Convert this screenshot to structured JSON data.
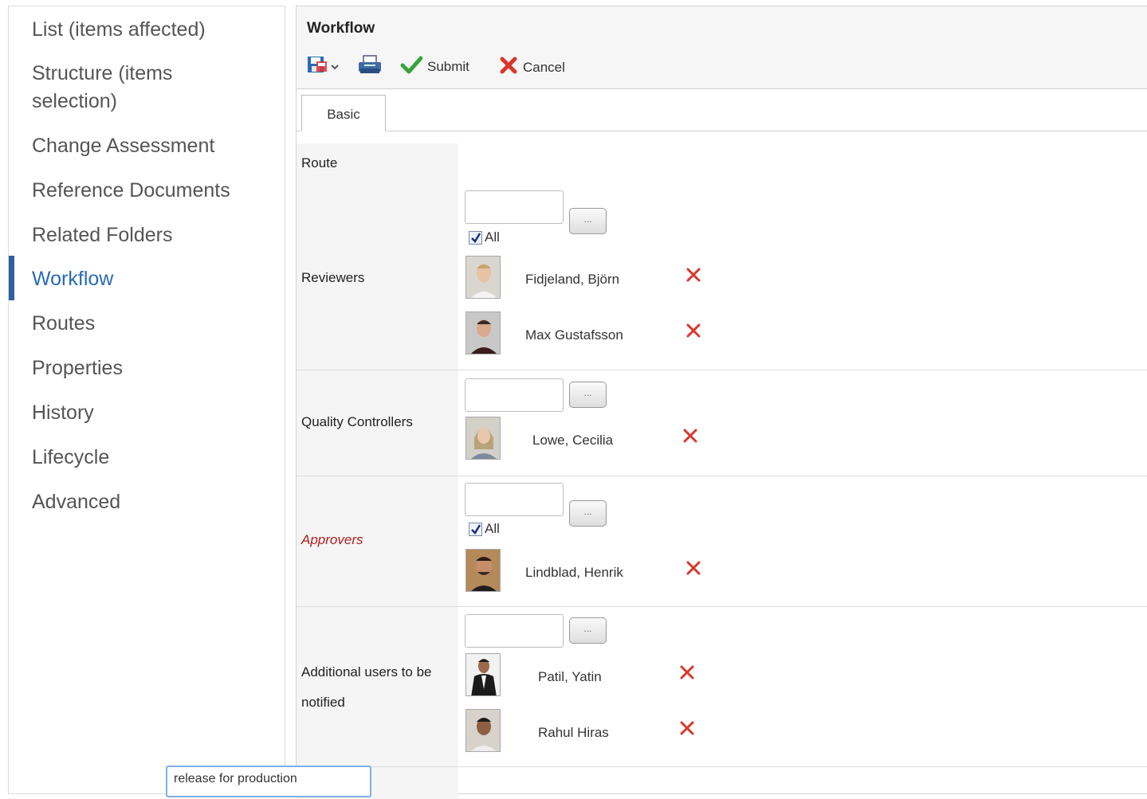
{
  "sidebar": {
    "items": [
      {
        "label": "List (items affected)"
      },
      {
        "label": "Structure (items selection)"
      },
      {
        "label": "Change Assessment"
      },
      {
        "label": "Reference Documents"
      },
      {
        "label": "Related Folders"
      },
      {
        "label": "Workflow"
      },
      {
        "label": "Routes"
      },
      {
        "label": "Properties"
      },
      {
        "label": "History"
      },
      {
        "label": "Lifecycle"
      },
      {
        "label": "Advanced"
      }
    ],
    "active": "Workflow"
  },
  "header": {
    "title": "Workflow",
    "toolbar": {
      "submit_label": "Submit",
      "cancel_label": "Cancel"
    }
  },
  "tabs": [
    {
      "label": "Basic"
    }
  ],
  "form": {
    "route_label": "Route",
    "reviewers": {
      "label": "Reviewers",
      "all_label": "All",
      "all_checked": true,
      "browse_label": "...",
      "users": [
        "Fidjeland, Björn",
        "Max Gustafsson"
      ]
    },
    "quality_controllers": {
      "label": "Quality Controllers",
      "browse_label": "...",
      "users": [
        "Lowe, Cecilia"
      ]
    },
    "approvers": {
      "label": "Approvers",
      "all_label": "All",
      "all_checked": true,
      "browse_label": "...",
      "users": [
        "Lindblad, Henrik"
      ]
    },
    "additional_users": {
      "label_line1": "Additional users to be",
      "label_line2": "notified",
      "browse_label": "...",
      "users": [
        "Patil, Yatin",
        "Rahul Hiras"
      ]
    },
    "description_value": "release for production"
  },
  "colors": {
    "accent": "#2a6ab5",
    "required": "#b01e1e",
    "remove": "#d9362b",
    "check": "#3aa23a"
  }
}
